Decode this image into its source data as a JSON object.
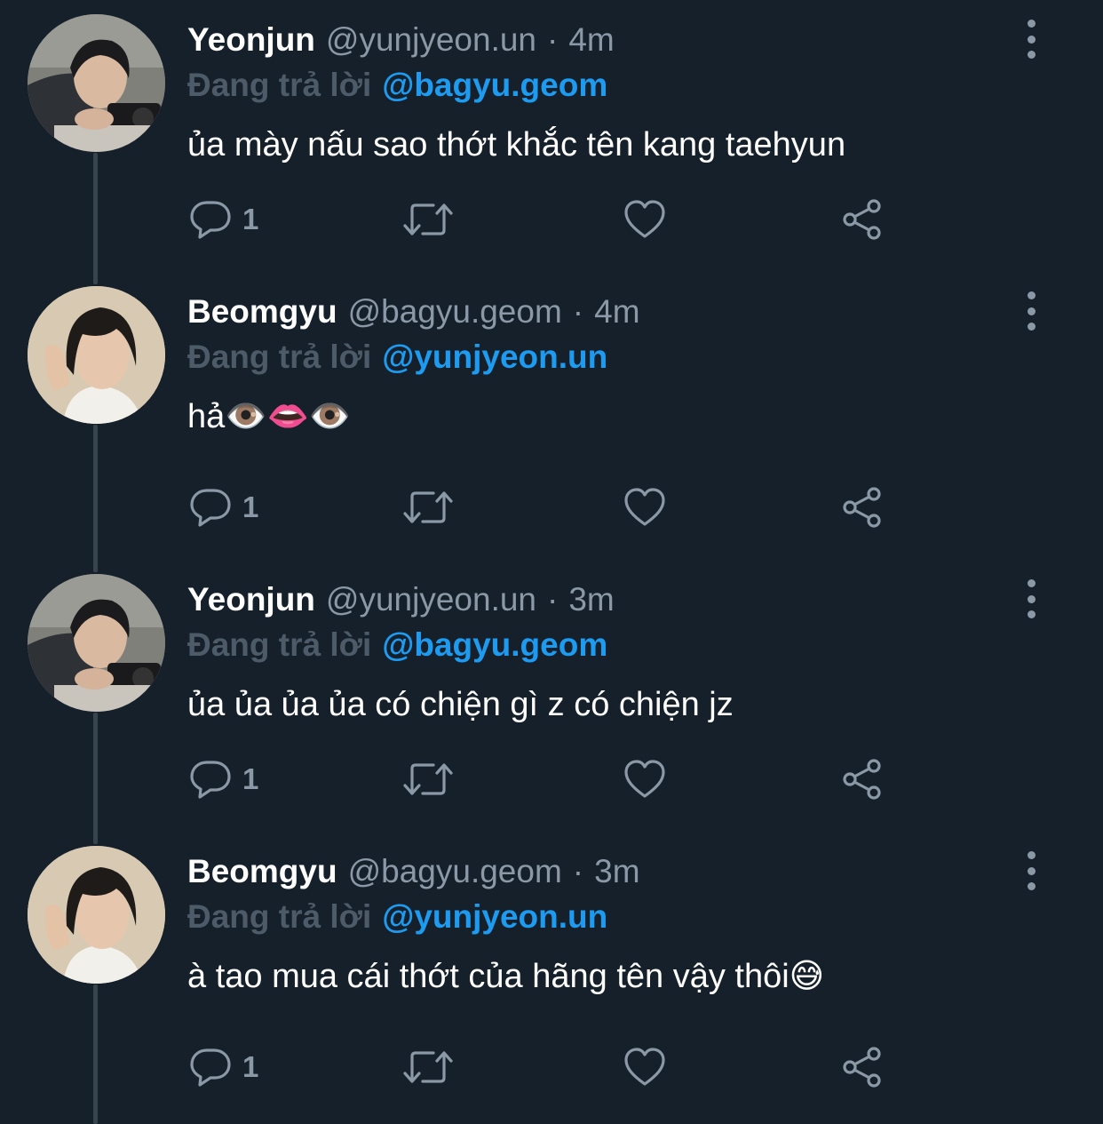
{
  "thread": {
    "tweets": [
      {
        "display_name": "Yeonjun",
        "handle": "@yunjyeon.un",
        "separator": "·",
        "time": "4m",
        "reply_prefix": "Đang trả lời",
        "reply_to": "@bagyu.geom",
        "text": "ủa mày nấu sao thớt khắc tên kang taehyun",
        "reply_count": "1",
        "avatar": "yeonjun-avatar"
      },
      {
        "display_name": "Beomgyu",
        "handle": "@bagyu.geom",
        "separator": "·",
        "time": "4m",
        "reply_prefix": "Đang trả lời",
        "reply_to": "@yunjyeon.un",
        "text": "hả👁️👄👁️",
        "reply_count": "1",
        "avatar": "beomgyu-avatar"
      },
      {
        "display_name": "Yeonjun",
        "handle": "@yunjyeon.un",
        "separator": "·",
        "time": "3m",
        "reply_prefix": "Đang trả lời",
        "reply_to": "@bagyu.geom",
        "text": "ủa ủa ủa ủa có chiện gì z có chiện jz",
        "reply_count": "1",
        "avatar": "yeonjun-avatar"
      },
      {
        "display_name": "Beomgyu",
        "handle": "@bagyu.geom",
        "separator": "·",
        "time": "3m",
        "reply_prefix": "Đang trả lời",
        "reply_to": "@yunjyeon.un",
        "text": "à tao mua cái thớt của hãng tên vậy thôi😅",
        "reply_count": "1",
        "avatar": "beomgyu-avatar"
      }
    ]
  },
  "icons": {
    "reply": "reply-icon",
    "retweet": "retweet-icon",
    "like": "heart-icon",
    "share": "share-icon",
    "more": "more-vertical-icon"
  },
  "colors": {
    "background": "#15202b",
    "primary_text": "#ffffff",
    "secondary_text": "#8b98a5",
    "mention": "#1d9bf0",
    "thread_line": "#38444d"
  }
}
